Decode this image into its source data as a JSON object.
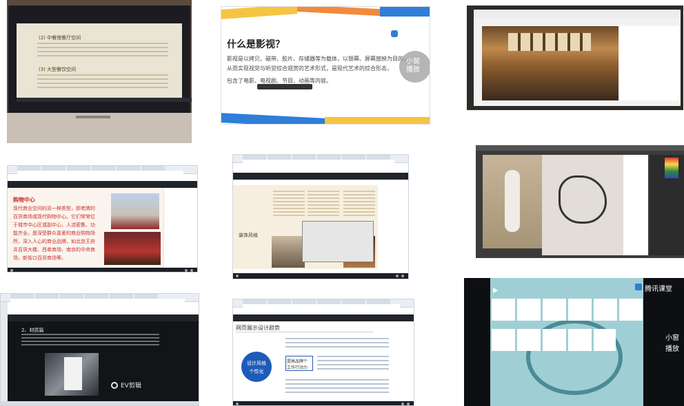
{
  "tile1": {
    "heading1": "(2) 中餐馆餐厅空间",
    "heading2": "(3) 大型餐饮空间"
  },
  "tile2": {
    "title": "什么是影视？",
    "line1": "影视是以拷贝、磁带、胶片、存储器等为载体，以银幕、屏幕放映为目的，",
    "line2": "从而实现视觉与听觉综合观赏的艺术形式，是现代艺术的综合形态，",
    "line3": "包含了电影、电视剧、节目、动画等内容。",
    "float_label": "小窗播放"
  },
  "tile4": {
    "heading": "购物中心",
    "body": "现代商业空间的另一种类型，即老牌的百货商场或现代购物中心。它们常常位于城市中心区或副中心，人流密集、功能齐全，是深受群众喜爱的商业购物场所，深入人心的商业品牌，如北京王府井百货大楼、西单商场、南京的中央商场、新街口百货商场等。"
  },
  "tile5": {
    "side_label": "装饰风格"
  },
  "tile7": {
    "heading": "2、材质篇",
    "watermark": "EV剪辑"
  },
  "tile8": {
    "title": "网页展示设计趋势",
    "circle_line1": "设计风格",
    "circle_line2": "个性化",
    "box1_line1": "提高品牌个",
    "box1_line2": "工作行动力"
  },
  "tile9": {
    "brand": "腾讯课堂",
    "float_line1": "小窗",
    "float_line2": "播放"
  },
  "colors": {
    "accent_red": "#c9302c",
    "accent_blue": "#1e5bb8",
    "dark_bg": "#20242b"
  }
}
